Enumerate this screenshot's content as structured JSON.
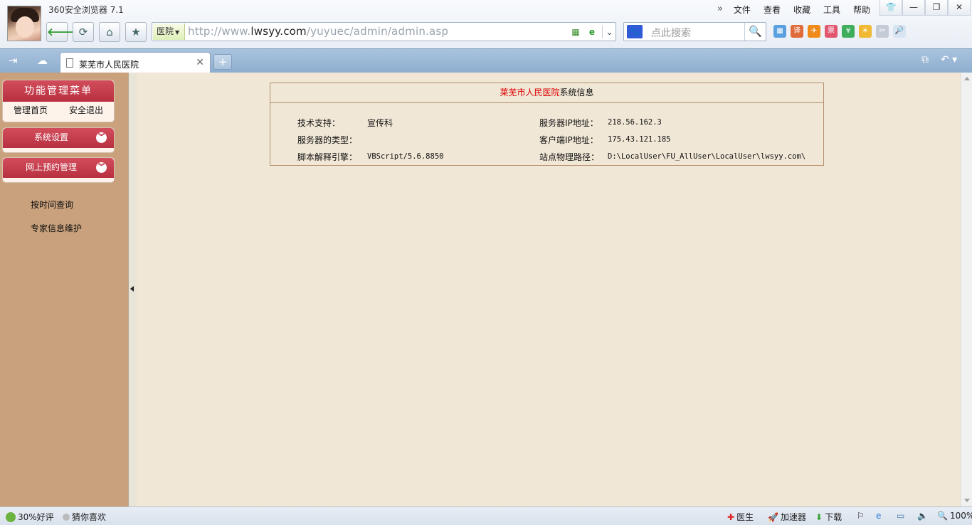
{
  "window": {
    "app_title": "360安全浏览器 7.1",
    "menu": [
      "文件",
      "查看",
      "收藏",
      "工具",
      "帮助"
    ],
    "controls": [
      "shirt-icon",
      "minimize",
      "restore",
      "close"
    ]
  },
  "navbar": {
    "address_tag": "医院",
    "url_prefix": "http://www.",
    "url_host": "lwsyy.com",
    "url_path": "/yuyuec/admin/admin.asp",
    "search_placeholder": "点此搜索"
  },
  "tabs": [
    {
      "label": "莱芜市人民医院",
      "active": true
    }
  ],
  "sidebar": {
    "title": "功能管理菜单",
    "links": [
      "管理首页",
      "安全退出"
    ],
    "sections": [
      {
        "label": "系统设置"
      },
      {
        "label": "网上预约管理"
      }
    ],
    "items": [
      "按时间查询",
      "专家信息维护"
    ]
  },
  "info": {
    "title_hospital": "莱芜市人民医院",
    "title_suffix": "系统信息",
    "rows": [
      {
        "label": "技术支持：",
        "value": "宣传科"
      },
      {
        "label": "服务器的类型：",
        "value": ""
      },
      {
        "label": "脚本解释引擎：",
        "value": "VBScript/5.6.8850"
      },
      {
        "label": "服务器IP地址：",
        "value": "218.56.162.3"
      },
      {
        "label": "客户端IP地址：",
        "value": "175.43.121.185"
      },
      {
        "label": "站点物理路径：",
        "value": "D:\\LocalUser\\FU_AllUser\\LocalUser\\lwsyy.com\\"
      }
    ]
  },
  "statusbar": {
    "left": [
      "30%好评",
      "猜你喜欢"
    ],
    "right": [
      "医生",
      "加速器",
      "下载"
    ],
    "zoom": "100%"
  },
  "colors": {
    "sidebar_bg": "#c9a17c",
    "main_bg": "#f0e7d6",
    "menu_header": "#c13a48",
    "hospital_red": "#dd0000"
  }
}
